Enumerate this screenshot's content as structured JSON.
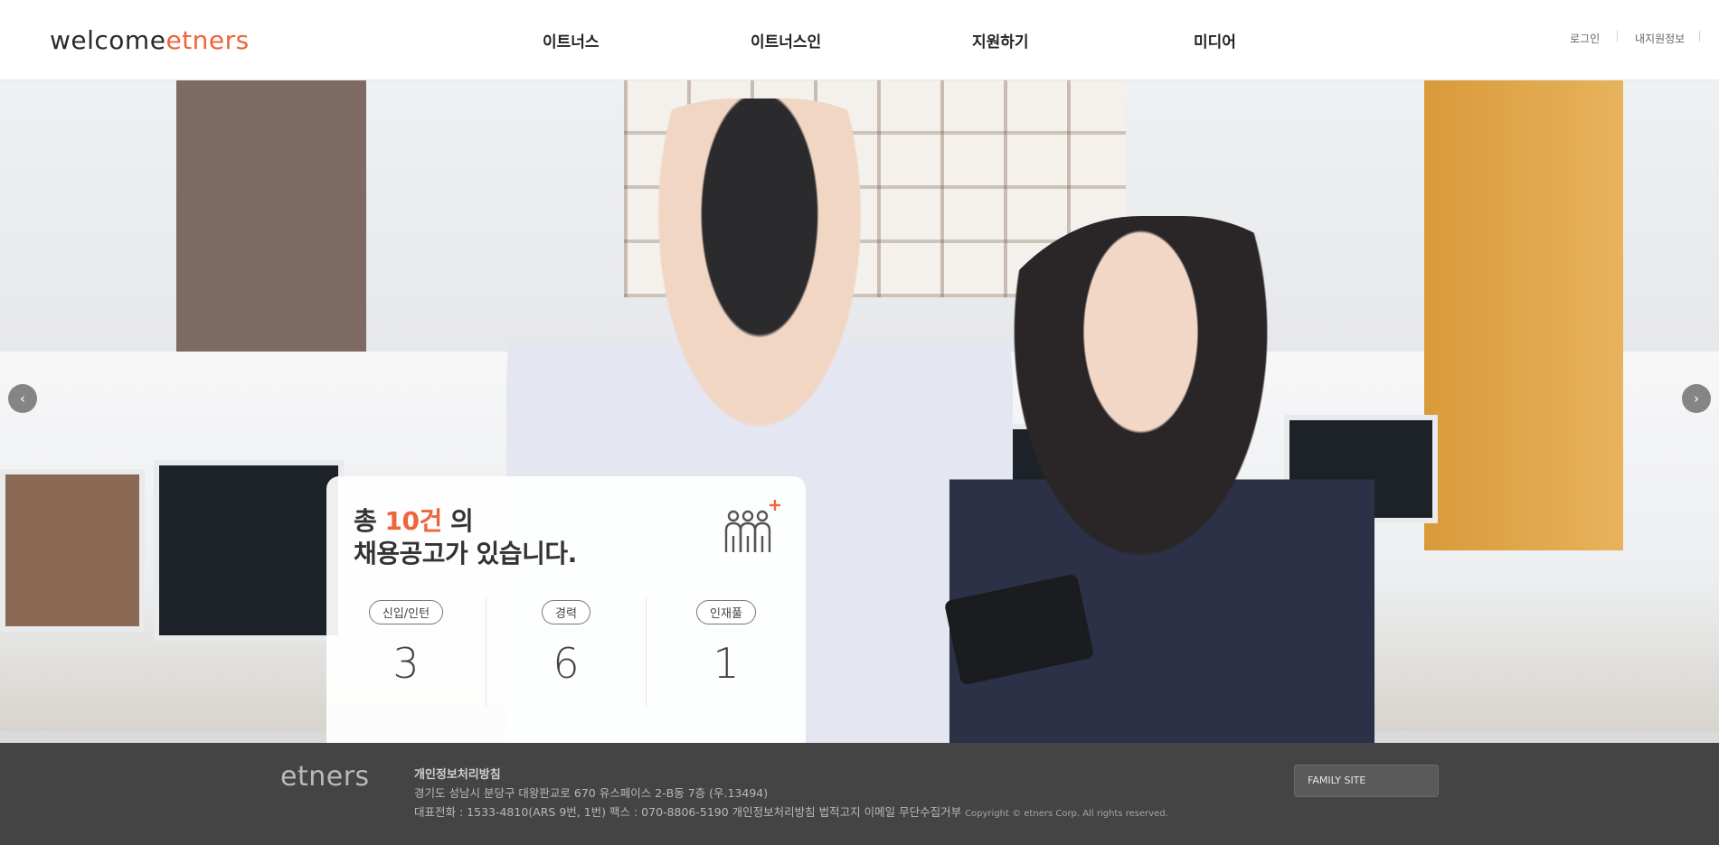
{
  "header": {
    "logo_part1": "welcome",
    "logo_part2": "etners",
    "nav": [
      "이트너스",
      "이트너스인",
      "지원하기",
      "미디어"
    ],
    "util": [
      "로그인",
      "내지원정보"
    ]
  },
  "hero": {
    "prev_arrow": "‹",
    "next_arrow": "›"
  },
  "card": {
    "title_prefix": "총",
    "title_count": "10건",
    "title_suffix": "의",
    "title_line2": "채용공고가 있습니다.",
    "categories": [
      {
        "label": "신입/인턴",
        "count": "3"
      },
      {
        "label": "경력",
        "count": "6"
      },
      {
        "label": "인재풀",
        "count": "1"
      }
    ],
    "icon": "people-plus-icon",
    "accent_color": "#f0643a"
  },
  "footer": {
    "logo": "etners",
    "privacy": "개인정보처리방침",
    "address": "경기도 성남시 분당구 대왕판교로 670 유스페이스 2-B동 7층 (우.13494)",
    "contact": "대표전화 : 1533-4810(ARS 9번, 1번) 팩스 : 070-8806-5190 개인정보처리방침 법적고지 이메일 무단수집거부",
    "copyright": "Copyright © etners Corp. All rights reserved.",
    "family_site": "FAMILY SITE"
  }
}
